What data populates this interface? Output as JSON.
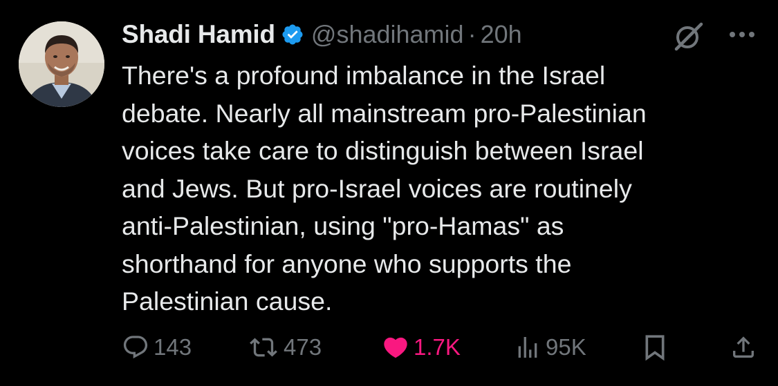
{
  "tweet": {
    "author_name": "Shadi Hamid",
    "handle": "@shadihamid",
    "separator": "·",
    "time": "20h",
    "text": "There's a profound imbalance in the Israel\ndebate. Nearly all mainstream pro-Palestinian\nvoices take care to distinguish between Israel\nand Jews. But pro-Israel voices are routinely\nanti-Palestinian, using \"pro-Hamas\" as\nshorthand for anyone who supports the\nPalestinian cause.",
    "liked": true
  },
  "actions": {
    "replies": "143",
    "reposts": "473",
    "likes": "1.7K",
    "views": "95K"
  },
  "icons": {
    "verified": "verified-badge-icon",
    "grok": "grok-icon",
    "more": "more-icon",
    "reply": "reply-icon",
    "repost": "repost-icon",
    "like": "heart-icon",
    "views": "views-icon",
    "bookmark": "bookmark-icon",
    "share": "share-icon"
  },
  "colors": {
    "background": "#000000",
    "text": "#e7e9ea",
    "secondary": "#71767b",
    "verified": "#1d9bf0",
    "like": "#f91880"
  }
}
